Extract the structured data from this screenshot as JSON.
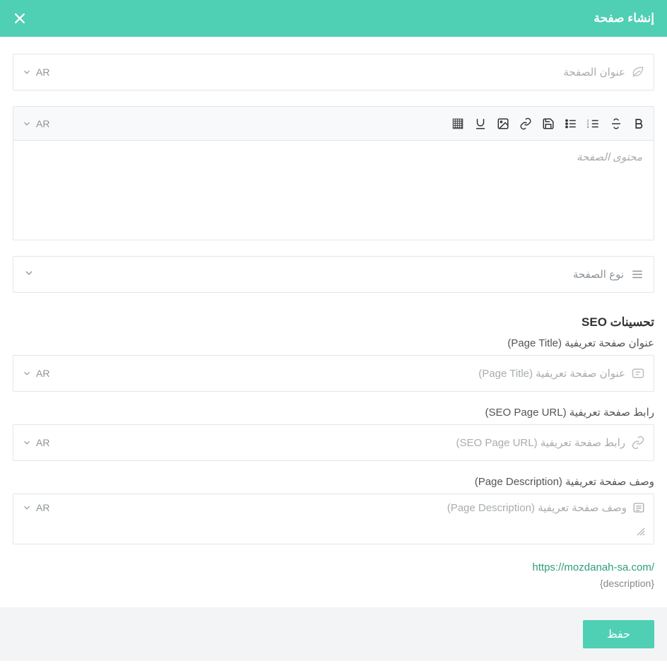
{
  "header": {
    "title": "إنشاء صفحة"
  },
  "lang_label": "AR",
  "title_field": {
    "placeholder": "عنوان الصفحة"
  },
  "content_field": {
    "placeholder": "محتوى الصفحة"
  },
  "page_type": {
    "placeholder": "نوع الصفحة"
  },
  "seo": {
    "section_title": "تحسينات SEO",
    "page_title_label": "عنوان صفحة تعريفية (Page Title)",
    "page_title_placeholder": "عنوان صفحة تعريفية (Page Title)",
    "page_url_label": "رابط صفحة تعريفية (SEO Page URL)",
    "page_url_placeholder": "رابط صفحة تعريفية (SEO Page URL)",
    "page_desc_label": "وصف صفحة تعريفية (Page Description)",
    "page_desc_placeholder": "وصف صفحة تعريفية (Page Description)"
  },
  "preview": {
    "url": "https://mozdanah-sa.com/",
    "description": "{description}"
  },
  "actions": {
    "save": "حفظ"
  }
}
